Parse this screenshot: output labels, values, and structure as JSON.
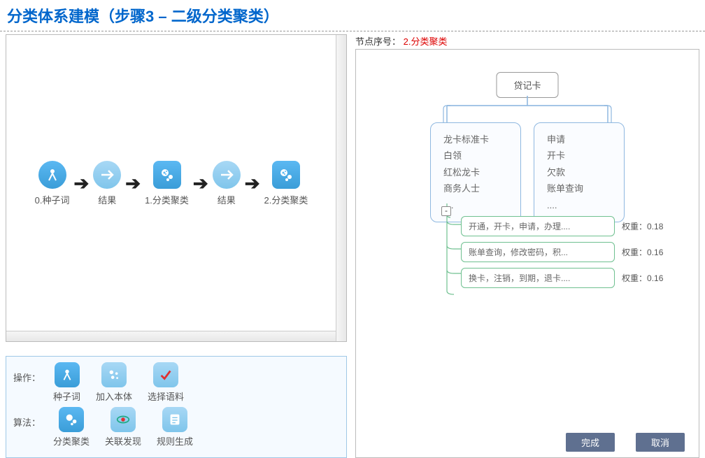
{
  "title": "分类体系建模（步骤3 – 二级分类聚类）",
  "flow": {
    "steps": [
      {
        "label": "0.种子词"
      },
      {
        "label": "结果"
      },
      {
        "label": "1.分类聚类"
      },
      {
        "label": "结果"
      },
      {
        "label": "2.分类聚类"
      }
    ]
  },
  "actions": {
    "op_label": "操作：",
    "alg_label": "算法：",
    "ops": [
      {
        "label": "种子词"
      },
      {
        "label": "加入本体"
      },
      {
        "label": "选择语料"
      }
    ],
    "algs": [
      {
        "label": "分类聚类"
      },
      {
        "label": "关联发现"
      },
      {
        "label": "规则生成"
      }
    ]
  },
  "right": {
    "node_label_prefix": "节点序号：",
    "node_label_value": " 2.分类聚类",
    "root": "贷记卡",
    "sub_left": [
      "龙卡标准卡",
      "白领",
      "红松龙卡",
      "商务人士",
      "...."
    ],
    "sub_right": [
      "申请",
      "开卡",
      "欠款",
      "账单查询",
      "...."
    ],
    "minus": "-",
    "clusters": [
      {
        "text": "开通，开卡，申请，办理....",
        "weight_label": "权重：",
        "weight_value": "0.18"
      },
      {
        "text": "账单查询，修改密码，积...",
        "weight_label": "权重：",
        "weight_value": "0.16"
      },
      {
        "text": "换卡，注销，到期，退卡....",
        "weight_label": "权重：",
        "weight_value": "0.16"
      }
    ]
  },
  "buttons": {
    "done": "完成",
    "cancel": "取消"
  }
}
